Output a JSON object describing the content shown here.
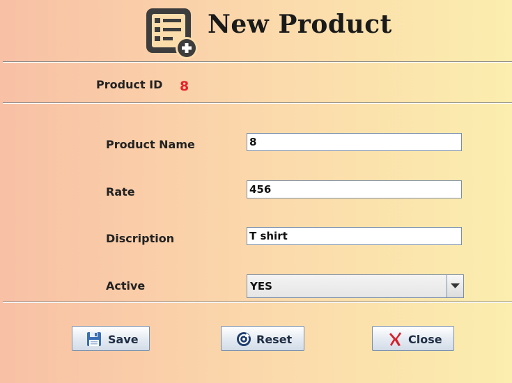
{
  "window": {
    "title": "New Product"
  },
  "product_id": {
    "label": "Product ID",
    "value": "8"
  },
  "fields": {
    "name": {
      "label": "Product Name",
      "value": "8"
    },
    "rate": {
      "label": "Rate",
      "value": "456"
    },
    "description": {
      "label": "Discription",
      "value": "T shirt"
    },
    "active": {
      "label": "Active",
      "value": "YES"
    }
  },
  "buttons": {
    "save": "Save",
    "reset": "Reset",
    "close": "Close"
  },
  "colors": {
    "id_value": "#e8202a",
    "close_icon": "#d8202a",
    "save_icon": "#3a6fb5"
  },
  "icons": [
    "new-product-icon",
    "save-icon",
    "reset-icon",
    "close-icon",
    "chevron-down-icon"
  ]
}
